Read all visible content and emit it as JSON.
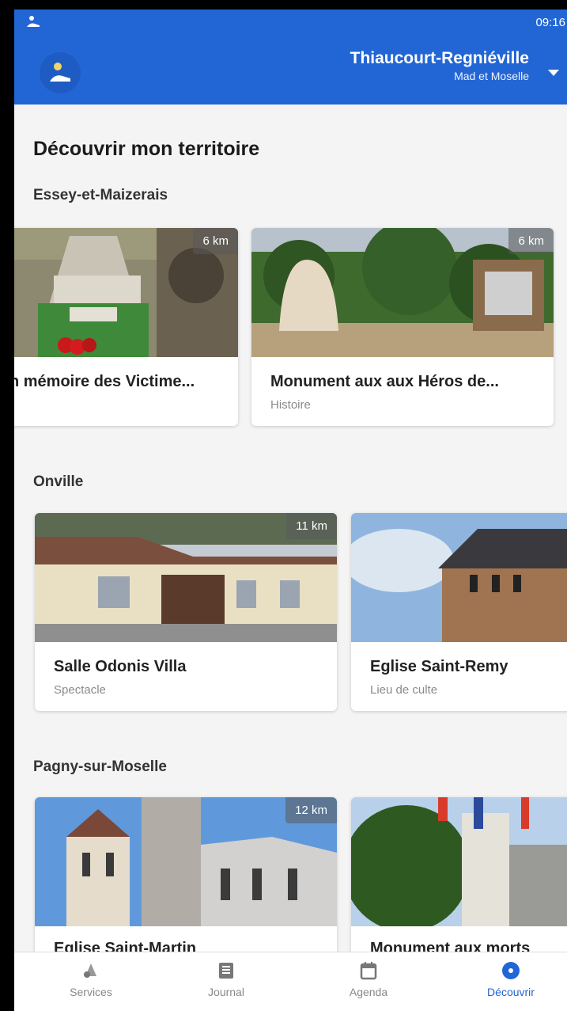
{
  "status_bar": {
    "time": "09:16"
  },
  "header": {
    "commune_name": "Thiaucourt-Regniéville",
    "commune_sub": "Mad et Moselle"
  },
  "page_title": "Découvrir mon territoire",
  "sections": [
    {
      "title": "Essey-et-Maizerais",
      "cards": [
        {
          "title": "n mémoire des Victime...",
          "category": "",
          "distance": "6 km"
        },
        {
          "title": "Monument aux aux Héros de...",
          "category": "Histoire",
          "distance": "6 km"
        }
      ]
    },
    {
      "title": "Onville",
      "cards": [
        {
          "title": "Salle Odonis Villa",
          "category": "Spectacle",
          "distance": "11 km"
        },
        {
          "title": "Eglise Saint-Remy",
          "category": "Lieu de culte",
          "distance": ""
        }
      ]
    },
    {
      "title": "Pagny-sur-Moselle",
      "cards": [
        {
          "title": "Eglise Saint-Martin",
          "category": "",
          "distance": "12 km"
        },
        {
          "title": "Monument aux morts",
          "category": "",
          "distance": ""
        }
      ]
    }
  ],
  "nav": [
    {
      "label": "Services",
      "icon": "services-icon",
      "active": false
    },
    {
      "label": "Journal",
      "icon": "journal-icon",
      "active": false
    },
    {
      "label": "Agenda",
      "icon": "calendar-icon",
      "active": false
    },
    {
      "label": "Découvrir",
      "icon": "compass-icon",
      "active": true
    }
  ],
  "colors": {
    "primary": "#2266d6",
    "background": "#f4f4f5"
  }
}
